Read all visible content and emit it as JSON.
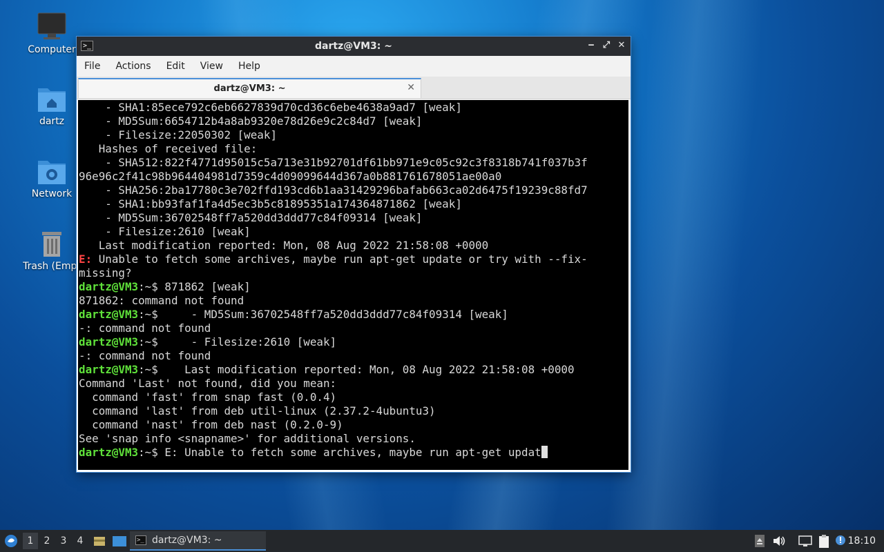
{
  "desktop": {
    "icons": [
      {
        "label": "Computer",
        "icon": "monitor-icon"
      },
      {
        "label": "dartz",
        "icon": "home-folder-icon"
      },
      {
        "label": "Network",
        "icon": "network-folder-icon"
      },
      {
        "label": "Trash (Empt",
        "icon": "trash-icon"
      }
    ]
  },
  "window": {
    "title": "dartz@VM3: ~",
    "controls": {
      "minimize": "‒",
      "maximize": "⤢",
      "close": "✕"
    },
    "menu": [
      "File",
      "Actions",
      "Edit",
      "View",
      "Help"
    ],
    "tab": {
      "label": "dartz@VM3: ~",
      "close": "✕"
    }
  },
  "terminal": {
    "prompt_user": "dartz@VM3",
    "prompt_path": ":~",
    "prompt_symbol": "$",
    "lines": [
      {
        "kind": "out",
        "text": "    - SHA1:85ece792c6eb6627839d70cd36c6ebe4638a9ad7 [weak]"
      },
      {
        "kind": "out",
        "text": "    - MD5Sum:6654712b4a8ab9320e78d26e9c2c84d7 [weak]"
      },
      {
        "kind": "out",
        "text": "    - Filesize:22050302 [weak]"
      },
      {
        "kind": "out",
        "text": "   Hashes of received file:"
      },
      {
        "kind": "out",
        "text": "    - SHA512:822f4771d95015c5a713e31b92701df61bb971e9c05c92c3f8318b741f037b3f"
      },
      {
        "kind": "out",
        "text": "96e96c2f41c98b964404981d7359c4d09099644d367a0b881761678051ae00a0"
      },
      {
        "kind": "out",
        "text": "    - SHA256:2ba17780c3e702ffd193cd6b1aa31429296bafab663ca02d6475f19239c88fd7"
      },
      {
        "kind": "out",
        "text": "    - SHA1:bb93faf1fa4d5ec3b5c81895351a174364871862 [weak]"
      },
      {
        "kind": "out",
        "text": "    - MD5Sum:36702548ff7a520dd3ddd77c84f09314 [weak]"
      },
      {
        "kind": "out",
        "text": "    - Filesize:2610 [weak]"
      },
      {
        "kind": "out",
        "text": "   Last modification reported: Mon, 08 Aug 2022 21:58:08 +0000"
      },
      {
        "kind": "err",
        "prefix": "E:",
        "text": " Unable to fetch some archives, maybe run apt-get update or try with --fix-"
      },
      {
        "kind": "out",
        "text": "missing?"
      },
      {
        "kind": "cmd",
        "text": " 871862 [weak]"
      },
      {
        "kind": "out",
        "text": "871862: command not found"
      },
      {
        "kind": "cmd",
        "text": "     - MD5Sum:36702548ff7a520dd3ddd77c84f09314 [weak]"
      },
      {
        "kind": "out",
        "text": "-: command not found"
      },
      {
        "kind": "cmd",
        "text": "     - Filesize:2610 [weak]"
      },
      {
        "kind": "out",
        "text": "-: command not found"
      },
      {
        "kind": "cmd",
        "text": "    Last modification reported: Mon, 08 Aug 2022 21:58:08 +0000"
      },
      {
        "kind": "out",
        "text": "Command 'Last' not found, did you mean:"
      },
      {
        "kind": "out",
        "text": "  command 'fast' from snap fast (0.0.4)"
      },
      {
        "kind": "out",
        "text": "  command 'last' from deb util-linux (2.37.2-4ubuntu3)"
      },
      {
        "kind": "out",
        "text": "  command 'nast' from deb nast (0.2.0-9)"
      },
      {
        "kind": "out",
        "text": "See 'snap info <snapname>' for additional versions."
      },
      {
        "kind": "input",
        "text": " E: Unable to fetch some archives, maybe run apt-get updat"
      }
    ]
  },
  "taskbar": {
    "workspaces": [
      "1",
      "2",
      "3",
      "4"
    ],
    "active_workspace": "1",
    "task_label": "dartz@VM3: ~",
    "clock": "18:10"
  },
  "colors": {
    "prompt_user": "#5fe13a",
    "error": "#ff4444",
    "accent": "#4a90d9"
  }
}
